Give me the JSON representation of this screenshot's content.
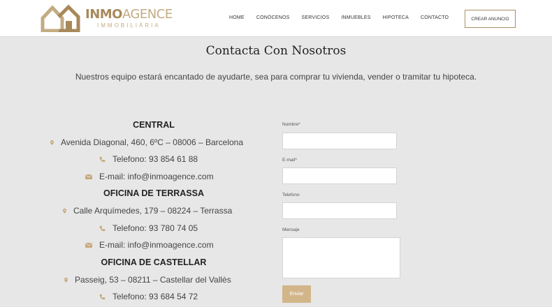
{
  "brand": {
    "name_bold": "INMO",
    "name_light": "AGENCE",
    "sub": "IMMOBILIÀRIA"
  },
  "nav": {
    "items": [
      "HOME",
      "CONÓCENOS",
      "SERVICIOS",
      "INMUEBLES",
      "HIPOTECA",
      "CONTACTO"
    ],
    "cta": "CREAR ANUNCIO"
  },
  "page": {
    "title": "Contacta Con Nosotros",
    "subtitle": "Nuestros equipo estará encantado de ayudarte, sea para comprar tu vivienda, vender o tramitar tu hipoteca."
  },
  "offices": [
    {
      "title": "CENTRAL",
      "address": "Avenida Diagonal, 460, 6ºC – 08006 –  Barcelona",
      "phone": "Telefono: 93 854 61 88",
      "email": "E-mail: info@inmoagence.com"
    },
    {
      "title": "OFICINA DE TERRASSA",
      "address": "Calle Arquímedes, 179 – 08224 –  Terrassa",
      "phone": "Telefono: 93 780 74 05",
      "email": "E-mail: info@inmoagence.com"
    },
    {
      "title": "OFICINA DE CASTELLAR",
      "address": "Passeig, 53 – 08211 –  Castellar del Vallès",
      "phone": "Telefono: 93 684 54 72"
    }
  ],
  "form": {
    "name_label": "Nombre*",
    "email_label": "E-mail*",
    "phone_label": "Telefono",
    "message_label": "Mensaje",
    "submit_label": "Enviar"
  },
  "colors": {
    "accent": "#a8895a",
    "button": "#d2b68a",
    "background": "#e7e7e7"
  }
}
